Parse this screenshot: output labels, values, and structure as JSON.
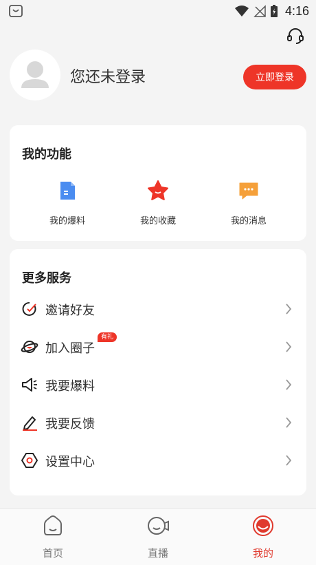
{
  "status_bar": {
    "time": "4:16"
  },
  "profile": {
    "status_text": "您还未登录",
    "login_button": "立即登录"
  },
  "features": {
    "title": "我的功能",
    "items": [
      {
        "label": "我的爆料",
        "icon": "document-icon"
      },
      {
        "label": "我的收藏",
        "icon": "star-icon"
      },
      {
        "label": "我的消息",
        "icon": "message-icon"
      }
    ]
  },
  "services": {
    "title": "更多服务",
    "items": [
      {
        "label": "邀请好友",
        "icon": "invite-icon"
      },
      {
        "label": "加入圈子",
        "icon": "planet-icon",
        "badge": "有礼"
      },
      {
        "label": "我要爆料",
        "icon": "megaphone-icon"
      },
      {
        "label": "我要反馈",
        "icon": "pen-icon"
      },
      {
        "label": "设置中心",
        "icon": "settings-icon"
      }
    ]
  },
  "tabbar": {
    "items": [
      {
        "label": "首页",
        "icon": "home-icon"
      },
      {
        "label": "直播",
        "icon": "live-icon"
      },
      {
        "label": "我的",
        "icon": "profile-icon",
        "active": true
      }
    ]
  },
  "colors": {
    "accent": "#ee3528",
    "background": "#f4f4f4",
    "card": "#ffffff"
  }
}
